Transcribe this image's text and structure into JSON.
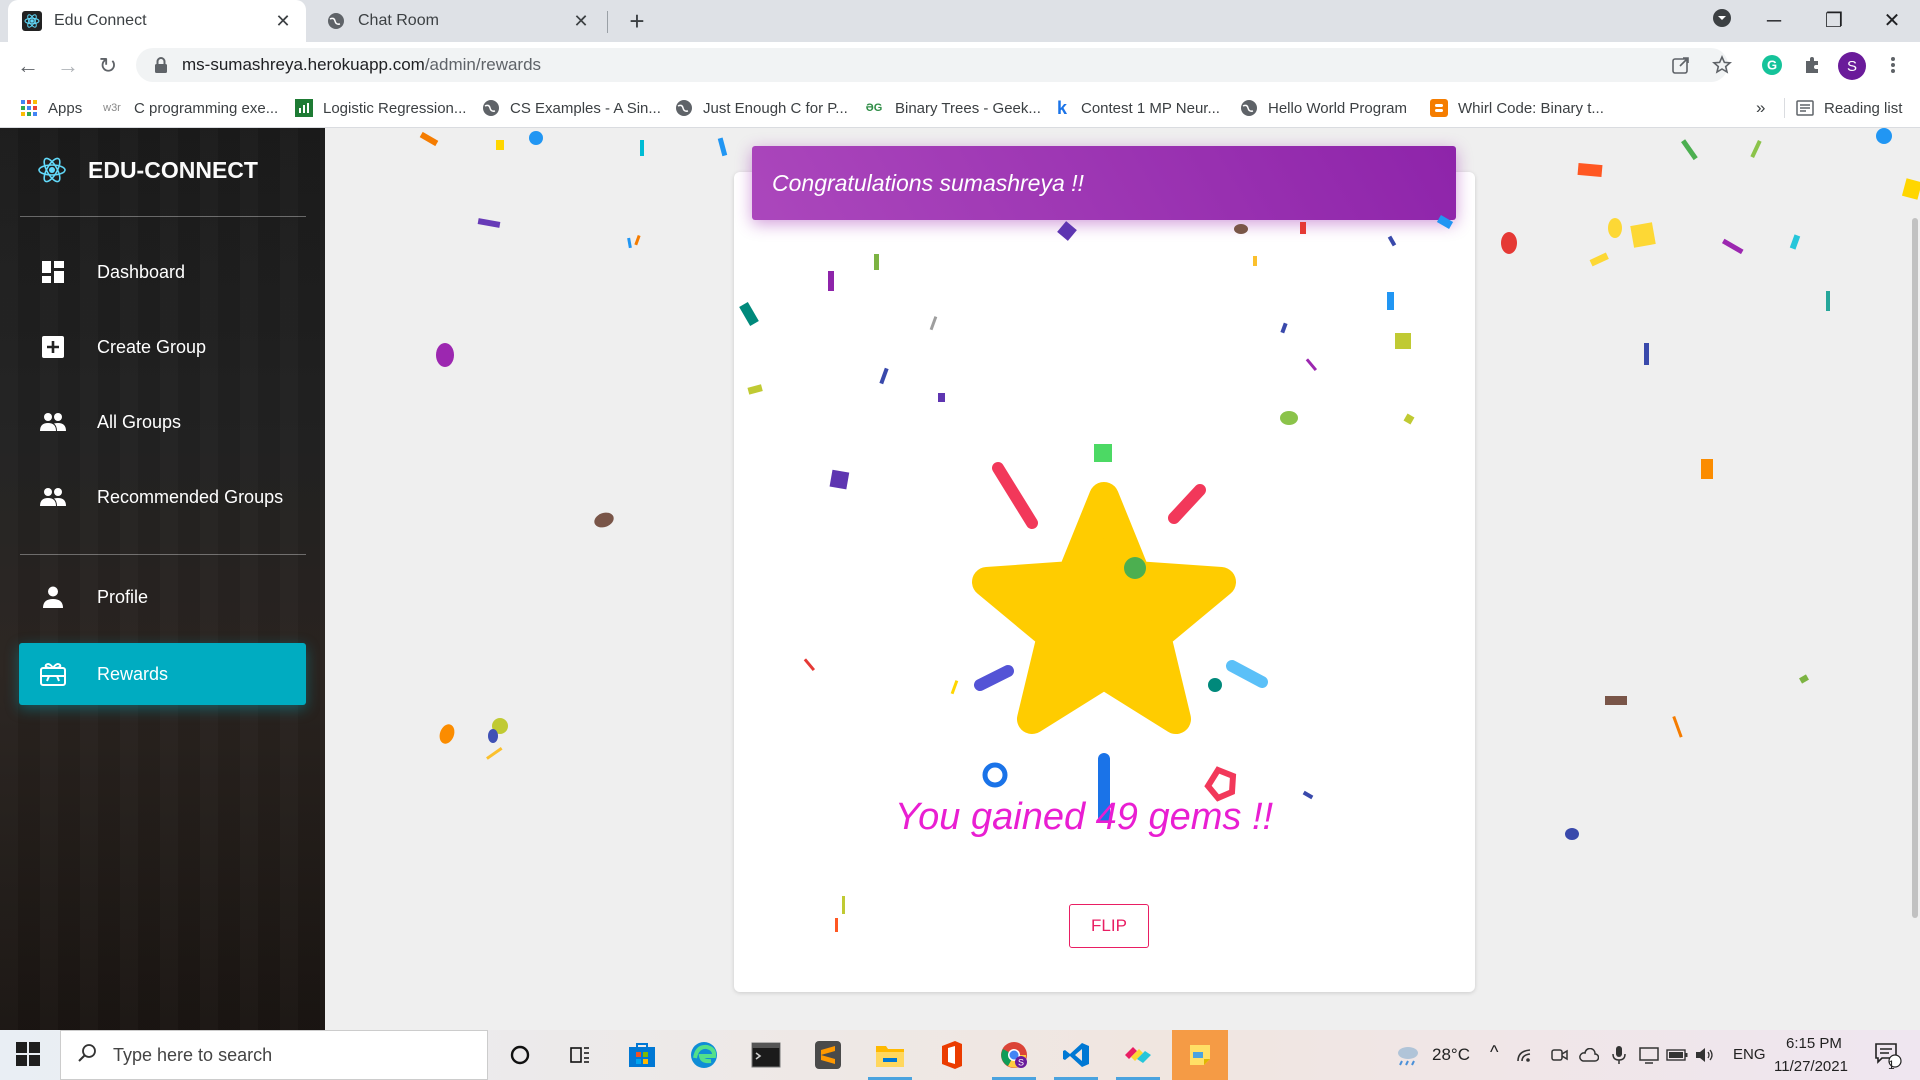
{
  "browser": {
    "tabs": [
      {
        "title": "Edu Connect",
        "active": true
      },
      {
        "title": "Chat Room",
        "active": false
      }
    ],
    "address": {
      "host": "ms-sumashreya.herokuapp.com",
      "path": "/admin/rewards"
    },
    "profile_initial": "S",
    "bookmarks": [
      {
        "label": "Apps",
        "icon": "apps-grid-icon"
      },
      {
        "label": "C programming exe...",
        "icon": "w3r-icon",
        "badge": "w3r"
      },
      {
        "label": "Logistic Regression...",
        "icon": "analytics-icon"
      },
      {
        "label": "CS Examples - A Sin...",
        "icon": "globe-icon"
      },
      {
        "label": "Just Enough C for P...",
        "icon": "globe-icon"
      },
      {
        "label": "Binary Trees - Geek...",
        "icon": "gfg-icon",
        "badge": "ƏG"
      },
      {
        "label": "Contest 1 MP Neur...",
        "icon": "k-icon",
        "badge": "k"
      },
      {
        "label": "Hello World Program",
        "icon": "globe-icon"
      },
      {
        "label": "Whirl Code: Binary t...",
        "icon": "blogger-icon"
      }
    ],
    "bookmarks_overflow": "»",
    "reading_list": "Reading list"
  },
  "sidebar": {
    "brand": "EDU-CONNECT",
    "items": [
      {
        "label": "Dashboard",
        "icon": "dashboard-icon",
        "active": false
      },
      {
        "label": "Create Group",
        "icon": "add-box-icon",
        "active": false
      },
      {
        "label": "All Groups",
        "icon": "people-icon",
        "active": false
      },
      {
        "label": "Recommended Groups",
        "icon": "people-icon",
        "active": false
      },
      {
        "label": "Profile",
        "icon": "person-icon",
        "active": false
      },
      {
        "label": "Rewards",
        "icon": "card-giftcard-icon",
        "active": true
      }
    ],
    "active_color": "#00acc1"
  },
  "rewards": {
    "header": "Congratulations sumashreya !!",
    "message": "You gained 49 gems !!",
    "flip_label": "FLIP",
    "header_color": "#9c27b0",
    "message_color": "#e91ed2",
    "star_color": "#ffcc00"
  },
  "taskbar": {
    "search_placeholder": "Type here to search",
    "weather": "28°C",
    "language": "ENG",
    "time": "6:15 PM",
    "date": "11/27/2021",
    "notification_count": "1"
  }
}
